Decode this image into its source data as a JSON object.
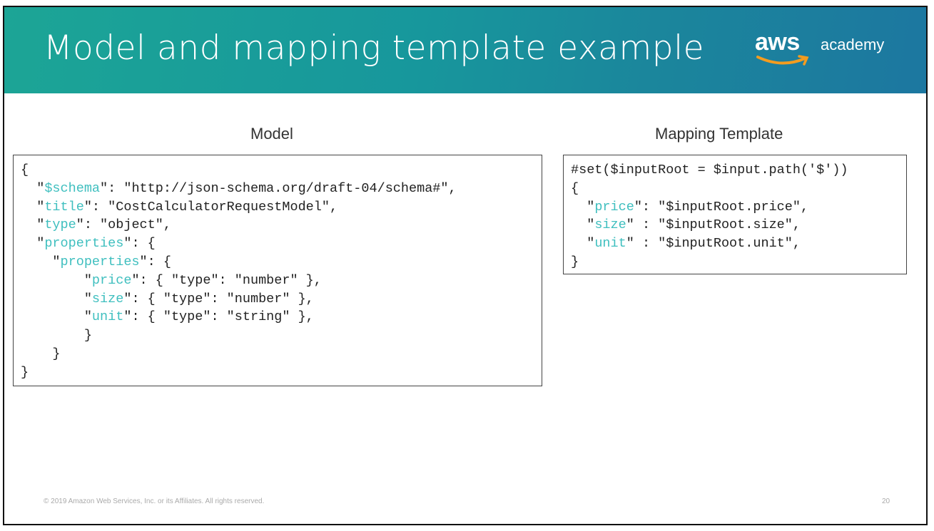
{
  "slide": {
    "title": "Model and mapping template example",
    "logo": {
      "wordmark": "aws",
      "suffix": "academy"
    },
    "footer": "© 2019 Amazon Web Services, Inc. or its Affiliates. All rights reserved.",
    "page_number": "20"
  },
  "colors": {
    "key": "#3fbfbf",
    "header_start": "#1ca596",
    "header_end": "#1c77a0",
    "smile": "#f39c1f"
  },
  "model": {
    "heading": "Model",
    "lines": [
      [
        [
          "{",
          "p"
        ]
      ],
      [
        [
          "  \"",
          "p"
        ],
        [
          "$schema",
          "k"
        ],
        [
          "\": \"http://json-schema.org/draft-04/schema#\",",
          "p"
        ]
      ],
      [
        [
          "  \"",
          "p"
        ],
        [
          "title",
          "k"
        ],
        [
          "\": \"CostCalculatorRequestModel\",",
          "p"
        ]
      ],
      [
        [
          "  \"",
          "p"
        ],
        [
          "type",
          "k"
        ],
        [
          "\": \"object\",",
          "p"
        ]
      ],
      [
        [
          "  \"",
          "p"
        ],
        [
          "properties",
          "k"
        ],
        [
          "\": {",
          "p"
        ]
      ],
      [
        [
          "    \"",
          "p"
        ],
        [
          "properties",
          "k"
        ],
        [
          "\": {",
          "p"
        ]
      ],
      [
        [
          "        \"",
          "p"
        ],
        [
          "price",
          "k"
        ],
        [
          "\": { \"type\": \"number\" },",
          "p"
        ]
      ],
      [
        [
          "        \"",
          "p"
        ],
        [
          "size",
          "k"
        ],
        [
          "\": { \"type\": \"number\" },",
          "p"
        ]
      ],
      [
        [
          "        \"",
          "p"
        ],
        [
          "unit",
          "k"
        ],
        [
          "\": { \"type\": \"string\" },",
          "p"
        ]
      ],
      [
        [
          "        }",
          "p"
        ]
      ],
      [
        [
          "    }",
          "p"
        ]
      ],
      [
        [
          "}",
          "p"
        ]
      ]
    ]
  },
  "mapping": {
    "heading": "Mapping Template",
    "lines": [
      [
        [
          "#set($inputRoot = $input.path('$'))",
          "p"
        ]
      ],
      [
        [
          "{",
          "p"
        ]
      ],
      [
        [
          "  \"",
          "p"
        ],
        [
          "price",
          "k"
        ],
        [
          "\": \"$inputRoot.price\",",
          "p"
        ]
      ],
      [
        [
          "  \"",
          "p"
        ],
        [
          "size",
          "k"
        ],
        [
          "\" : \"$inputRoot.size\",",
          "p"
        ]
      ],
      [
        [
          "  \"",
          "p"
        ],
        [
          "unit",
          "k"
        ],
        [
          "\" : \"$inputRoot.unit\",",
          "p"
        ]
      ],
      [
        [
          "}",
          "p"
        ]
      ]
    ]
  }
}
